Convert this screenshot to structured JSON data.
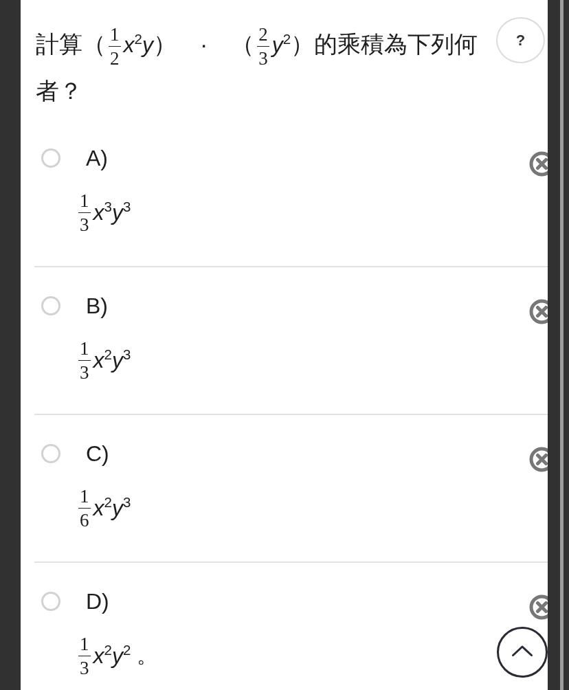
{
  "question": {
    "parts": [
      {
        "kind": "text",
        "text": "計算（"
      },
      {
        "kind": "frac",
        "num": "1",
        "den": "2"
      },
      {
        "kind": "math",
        "text": "x$^{2}$y"
      },
      {
        "kind": "text",
        "text": "）　·　（"
      },
      {
        "kind": "frac",
        "num": "2",
        "den": "3"
      },
      {
        "kind": "math",
        "text": "y$^{2}$"
      },
      {
        "kind": "text",
        "text": "）的乘積為下列何者？"
      }
    ]
  },
  "help_button": {
    "label": "?"
  },
  "options": [
    {
      "letter": "A)",
      "selected": false,
      "answer": [
        {
          "kind": "frac",
          "num": "1",
          "den": "3"
        },
        {
          "kind": "math",
          "text": "x$^{3}$y$^{3}$"
        }
      ]
    },
    {
      "letter": "B)",
      "selected": false,
      "answer": [
        {
          "kind": "frac",
          "num": "1",
          "den": "3"
        },
        {
          "kind": "math",
          "text": "x$^{2}$y$^{3}$"
        }
      ]
    },
    {
      "letter": "C)",
      "selected": false,
      "answer": [
        {
          "kind": "frac",
          "num": "1",
          "den": "6"
        },
        {
          "kind": "math",
          "text": "x$^{2}$y$^{3}$"
        }
      ]
    },
    {
      "letter": "D)",
      "selected": false,
      "answer": [
        {
          "kind": "frac",
          "num": "1",
          "den": "3"
        },
        {
          "kind": "math",
          "text": "x$^{2}$y$^{2}$"
        },
        {
          "kind": "text",
          "text": " 。"
        }
      ]
    }
  ]
}
